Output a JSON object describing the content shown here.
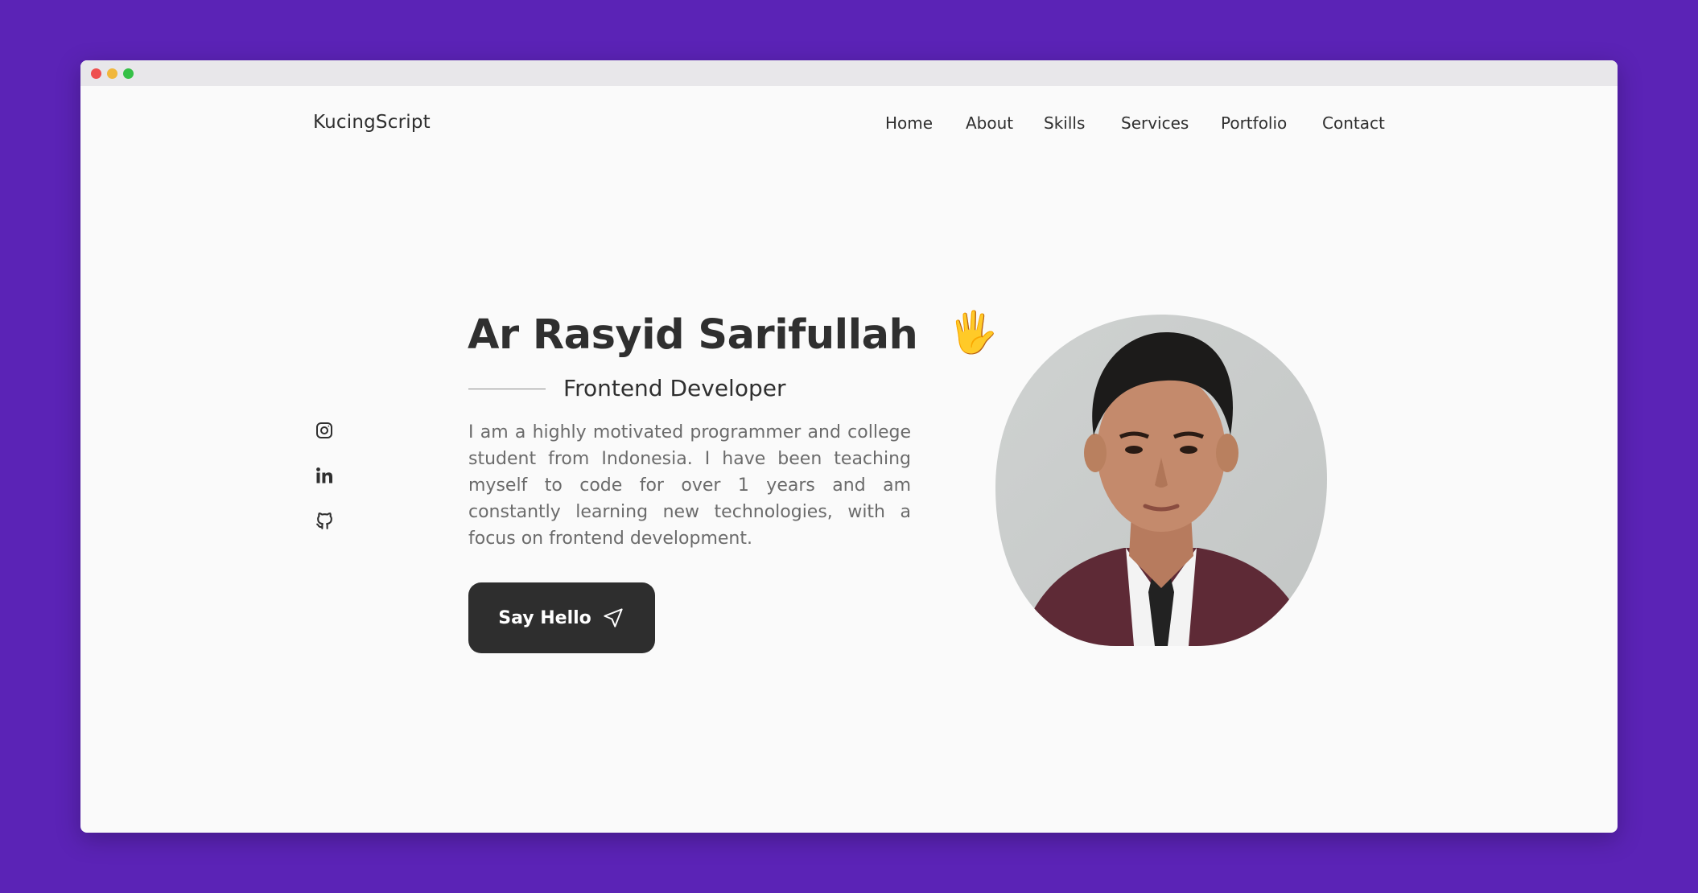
{
  "app": {
    "logo": "KucingScript"
  },
  "nav": {
    "items": [
      {
        "label": "Home"
      },
      {
        "label": "About"
      },
      {
        "label": "Skills"
      },
      {
        "label": "Services"
      },
      {
        "label": "Portfolio"
      },
      {
        "label": "Contact"
      }
    ]
  },
  "socials": [
    {
      "icon": "instagram-icon"
    },
    {
      "icon": "linkedin-icon"
    },
    {
      "icon": "github-icon"
    }
  ],
  "hero": {
    "name": "Ar Rasyid Sarifullah",
    "wave_emoji": "🖐",
    "subtitle": "Frontend Developer",
    "description": "I am a highly motivated programmer and college student from Indonesia. I have been teaching myself to code for over 1 years and am constantly learning new technologies, with a focus on frontend development.",
    "button_label": "Say Hello",
    "button_icon": "send-icon"
  },
  "colors": {
    "background": "#5b23b6",
    "page": "#fafafa",
    "text": "#2f2f2f",
    "button": "#2e2e2e"
  }
}
